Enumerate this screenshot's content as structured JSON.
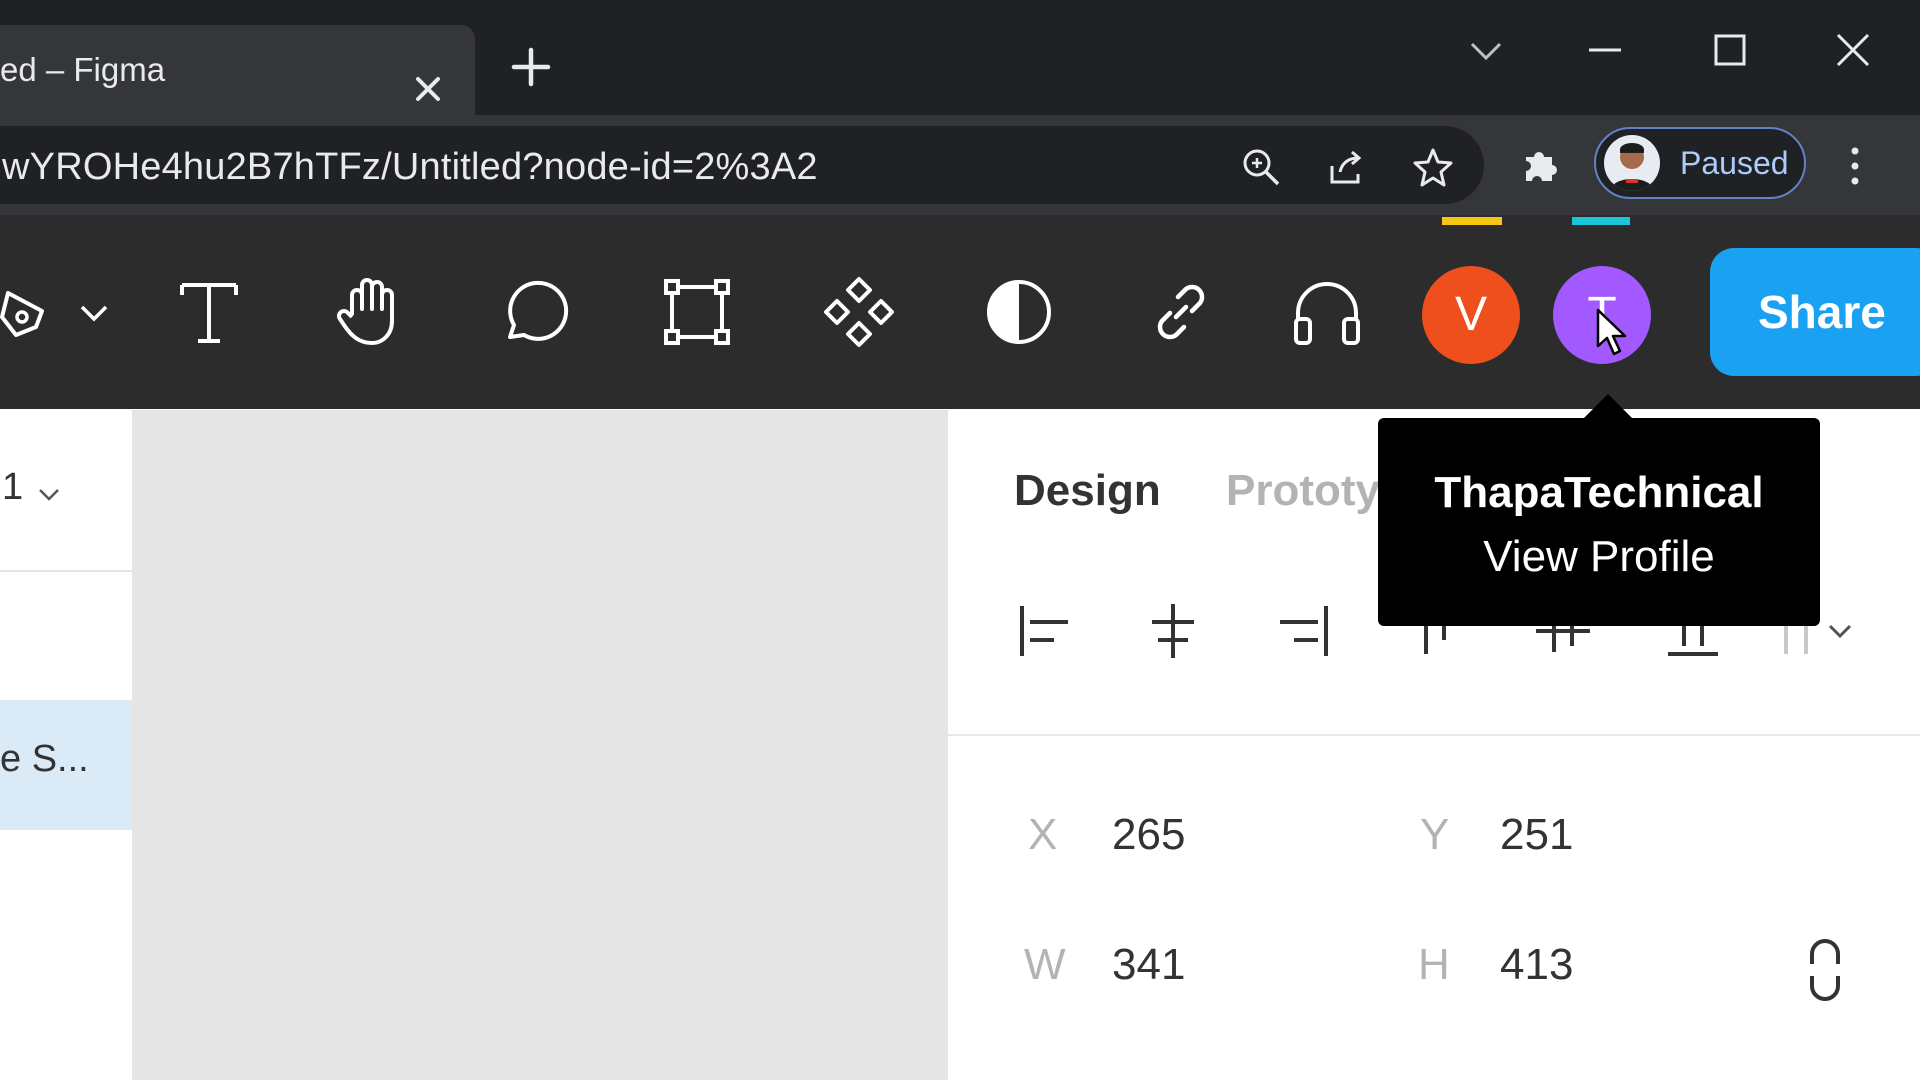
{
  "browser": {
    "tab_title": "ed – Figma",
    "url": "wYROHe4hu2B7hTFz/Untitled?node-id=2%3A2",
    "profile_status": "Paused",
    "icons": [
      "close-icon",
      "plus-icon",
      "chevron-down-icon",
      "minimize-icon",
      "maximize-icon",
      "close-icon",
      "zoom-icon",
      "share-icon",
      "star-icon",
      "extensions-icon",
      "more-vert-icon"
    ]
  },
  "toolbar": {
    "tools": [
      "pen-tool-icon",
      "chevron-down-icon",
      "text-tool-icon",
      "hand-tool-icon",
      "comment-tool-icon",
      "frame-tool-icon",
      "component-icon",
      "contrast-icon",
      "link-icon",
      "headphones-icon"
    ],
    "users": [
      {
        "initial": "V",
        "color": "#ee4f1d"
      },
      {
        "initial": "T",
        "color": "#a259ff"
      }
    ],
    "share_label": "Share"
  },
  "layers": {
    "page_label": "1",
    "selected_layer": "e S..."
  },
  "design_panel": {
    "tabs": [
      "Design",
      "Prototy"
    ],
    "x_label": "X",
    "x_value": "265",
    "y_label": "Y",
    "y_value": "251",
    "w_label": "W",
    "w_value": "341",
    "h_label": "H",
    "h_value": "413"
  },
  "tooltip": {
    "name": "ThapaTechnical",
    "link": "View Profile"
  }
}
